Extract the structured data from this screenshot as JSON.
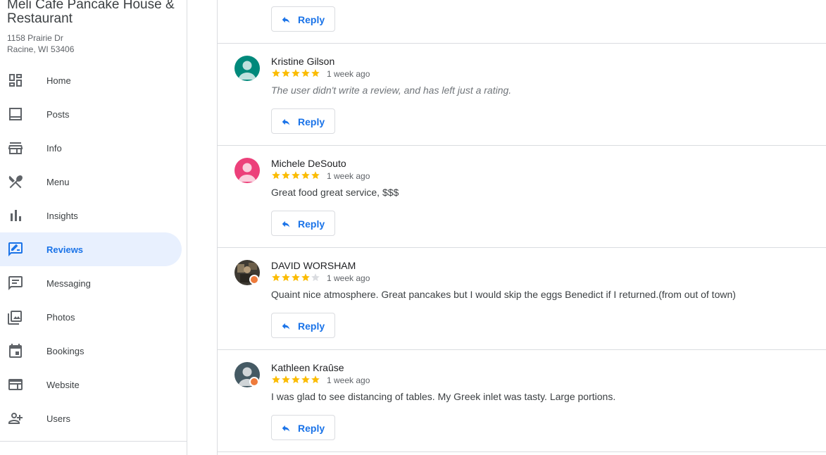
{
  "business": {
    "name": "Meli Cafe Pancake House & Restaurant",
    "address_line1": "1158 Prairie Dr",
    "address_line2": "Racine, WI 53406"
  },
  "nav": [
    {
      "label": "Home",
      "icon": "dashboard-icon"
    },
    {
      "label": "Posts",
      "icon": "posts-icon"
    },
    {
      "label": "Info",
      "icon": "storefront-icon"
    },
    {
      "label": "Menu",
      "icon": "fork-knife-icon"
    },
    {
      "label": "Insights",
      "icon": "bar-chart-icon"
    },
    {
      "label": "Reviews",
      "icon": "rate-review-icon",
      "active": true
    },
    {
      "label": "Messaging",
      "icon": "message-icon"
    },
    {
      "label": "Photos",
      "icon": "photos-icon"
    },
    {
      "label": "Bookings",
      "icon": "calendar-icon"
    },
    {
      "label": "Website",
      "icon": "web-icon"
    },
    {
      "label": "Users",
      "icon": "add-user-icon"
    }
  ],
  "colors": {
    "accent": "#1a73e8",
    "active_bg": "#e8f0fe",
    "star": "#fbbc04",
    "star_empty": "#dadce0"
  },
  "reply_label": "Reply",
  "reviews": [
    {
      "name": "Kristine Gilson",
      "rating": 5,
      "time": "1 week ago",
      "text": "The user didn't write a review, and has left just a rating.",
      "no_text": true,
      "avatar_color": "#00897b"
    },
    {
      "name": "Michele DeSouto",
      "rating": 5,
      "time": "1 week ago",
      "text": "Great food great service, $$$",
      "avatar_color": "#ec407a"
    },
    {
      "name": "DAVID WORSHAM",
      "rating": 4,
      "time": "1 week ago",
      "text": "Quaint nice atmosphere. Great pancakes but I would skip the eggs Benedict if I returned.(from out of town)",
      "avatar_color": "#3e3a33",
      "local_guide": true
    },
    {
      "name": "Kathleen Kraûse",
      "rating": 5,
      "time": "1 week ago",
      "text": "I was glad to see distancing of tables. My Greek inlet was tasty. Large portions.",
      "avatar_color": "#455a64",
      "local_guide": true
    }
  ]
}
